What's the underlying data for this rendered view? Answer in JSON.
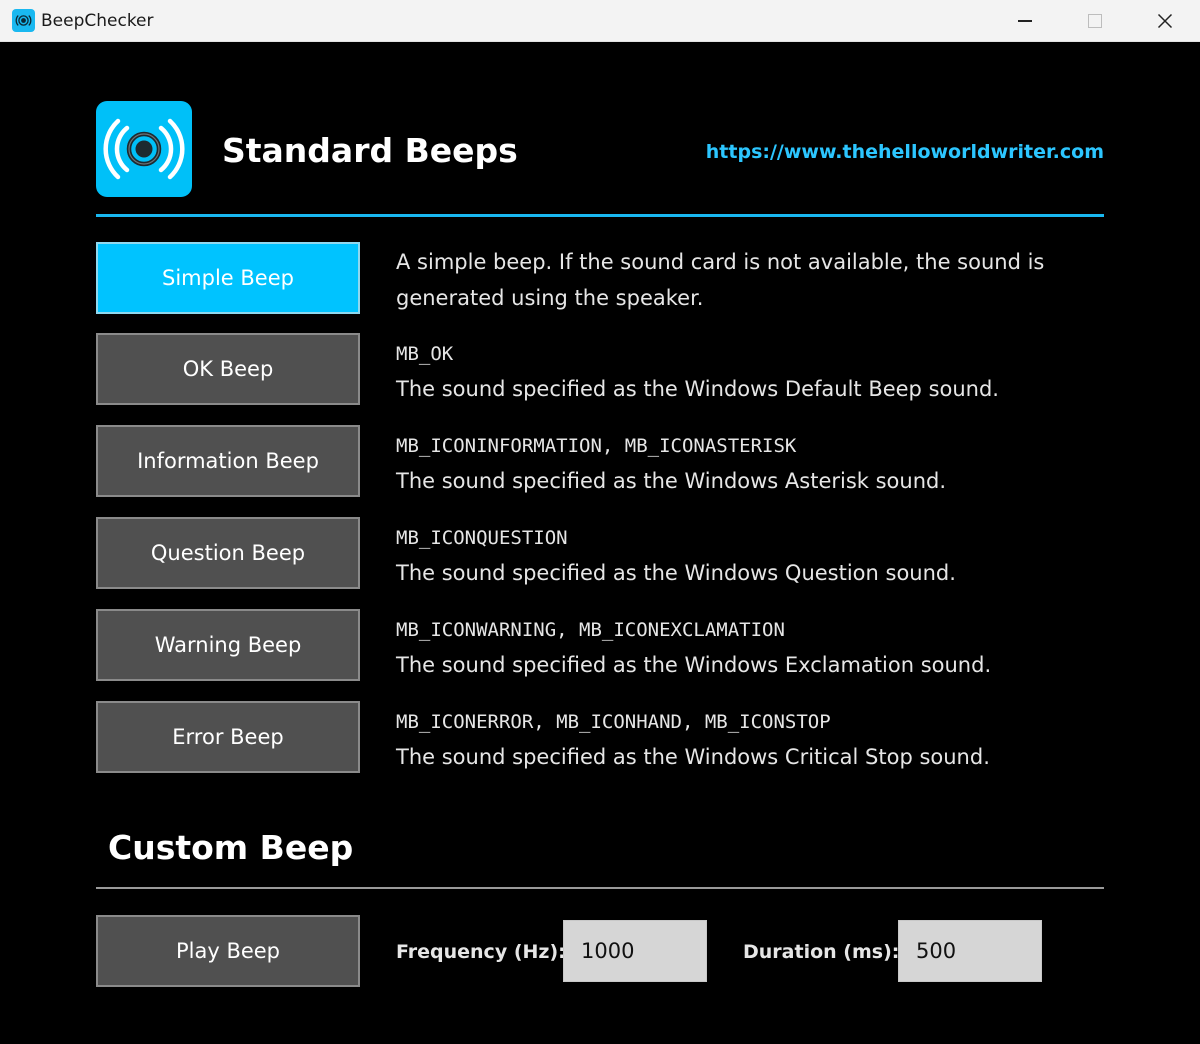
{
  "window": {
    "title": "BeepChecker",
    "icons": {
      "app": "speaker-wave-icon",
      "minimize": "minimize-icon",
      "maximize": "maximize-icon",
      "close": "close-icon"
    }
  },
  "header": {
    "title": "Standard Beeps",
    "link": "https://www.thehelloworldwriter.com",
    "logo_icon": "broadcast-icon"
  },
  "beeps": [
    {
      "label": "Simple Beep",
      "code": "",
      "description": "A simple beep. If the sound card is not available, the sound is generated using the speaker."
    },
    {
      "label": "OK Beep",
      "code": "MB_OK",
      "description": "The sound specified as the Windows Default Beep sound."
    },
    {
      "label": "Information Beep",
      "code": "MB_ICONINFORMATION, MB_ICONASTERISK",
      "description": "The sound specified as the Windows Asterisk sound."
    },
    {
      "label": "Question Beep",
      "code": "MB_ICONQUESTION",
      "description": "The sound specified as the Windows Question sound."
    },
    {
      "label": "Warning Beep",
      "code": "MB_ICONWARNING, MB_ICONEXCLAMATION",
      "description": "The sound specified as the Windows Exclamation sound."
    },
    {
      "label": "Error Beep",
      "code": "MB_ICONERROR, MB_ICONHAND, MB_ICONSTOP",
      "description": "The sound specified as the Windows Critical Stop sound."
    }
  ],
  "custom": {
    "title": "Custom Beep",
    "play_label": "Play Beep",
    "frequency_label": "Frequency (Hz):",
    "frequency_value": "1000",
    "duration_label": "Duration (ms):",
    "duration_value": "500"
  },
  "colors": {
    "accent": "#00c3ff",
    "link": "#2cc6ff",
    "button": "#505050",
    "background": "#000000"
  }
}
